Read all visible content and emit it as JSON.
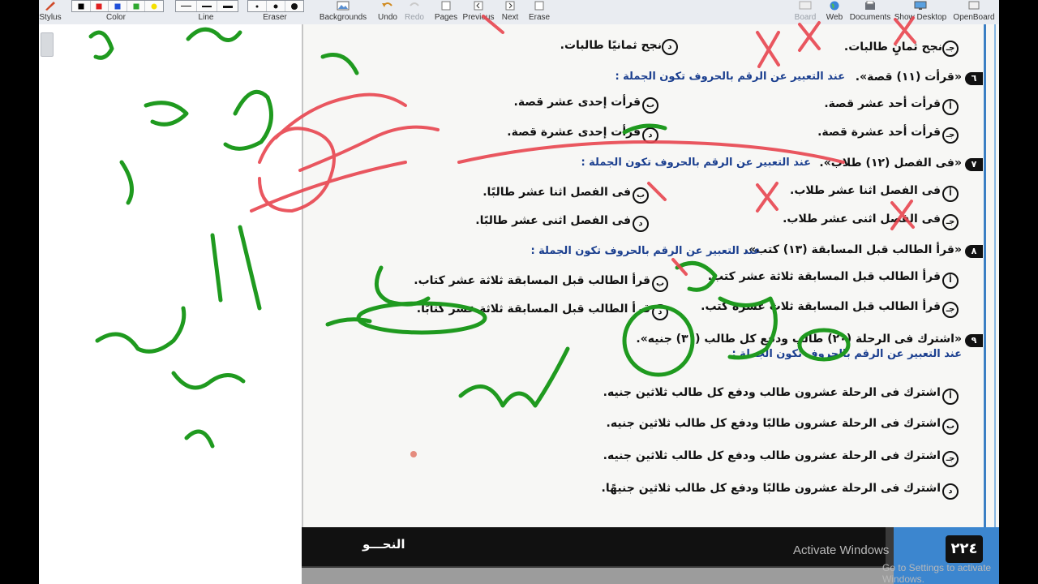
{
  "toolbar": {
    "stylus": "Stylus",
    "color": "Color",
    "line": "Line",
    "eraser": "Eraser",
    "backgrounds": "Backgrounds",
    "undo": "Undo",
    "redo": "Redo",
    "pages": "Pages",
    "previous": "Previous",
    "next": "Next",
    "erase": "Erase",
    "board": "Board",
    "web": "Web",
    "documents": "Documents",
    "show_desktop": "Show Desktop",
    "openboard": "OpenBoard",
    "colors": [
      "#000000",
      "#e02020",
      "#1f4fd8",
      "#2fa82f",
      "#f5e000"
    ]
  },
  "page": {
    "top_option_d": "نجح ثمانيًا طالبات.",
    "top_option_c": "نجح ثمانٍ طالبات.",
    "q6": {
      "num": "٦",
      "stem": "«قرأت (١١) قصة».",
      "instruction": "عند التعبير عن الرقم بالحروف تكون الجملة :",
      "a": "قرأت أحد عشر قصة.",
      "b": "قرأت إحدى عشر قصة.",
      "c": "قرأت أحد عشرة قصة.",
      "d": "قرأت إحدى عشرة قصة."
    },
    "q7": {
      "num": "٧",
      "stem": "«فى الفصل (١٢) طلاب».",
      "instruction": "عند التعبير عن الرقم بالحروف تكون الجملة :",
      "a": "فى الفصل اثنا عشر طلاب.",
      "b": "فى الفصل اثنا عشر طالبًا.",
      "c": "فى الفصل اثنى عشر طلاب.",
      "d": "فى الفصل اثنى عشر طالبًا."
    },
    "q8": {
      "num": "٨",
      "stem": "«قرأ الطالب قبل المسابقة (١٣) كتب».",
      "instruction": "عند التعبير عن الرقم بالحروف تكون الجملة :",
      "a": "قرأ الطالب قبل المسابقة ثلاثة عشر كتب.",
      "b": "قرأ الطالب قبل المسابقة ثلاثة عشر كتاب.",
      "c": "قرأ الطالب قبل المسابقة ثلاث عشرة كتب.",
      "d": "قرأ الطالب قبل المسابقة ثلاثة عشر كتابًا."
    },
    "q9": {
      "num": "٩",
      "stem": "«اشترك فى الرحلة (٢٠) طالب ودفع كل طالب (٣٠) جنيه».",
      "instruction": "عند التعبير عن الرقم بالحروف تكون الجملة :",
      "a": "اشترك فى الرحلة عشرون طالب ودفع كل طالب ثلاثين جنيه.",
      "b": "اشترك فى الرحلة عشرون طالبًا ودفع كل طالب ثلاثين جنيه.",
      "c": "اشترك فى الرحلة عشرون طالب ودفع كل طالب ثلاثين جنيه.",
      "d": "اشترك فى الرحلة عشرون طالبًا ودفع كل طالب ثلاثين جنيهًا."
    },
    "labels": {
      "a": "أ",
      "b": "ب",
      "c": "جـ",
      "d": "د"
    },
    "footer_subject": "النحـــو",
    "page_number": "٢٢٤"
  },
  "watermark": {
    "line1": "Activate Windows",
    "line2": "Go to Settings to activate Windows."
  },
  "ink": {
    "green": "#1f9a1f",
    "red": "#e8454f"
  }
}
